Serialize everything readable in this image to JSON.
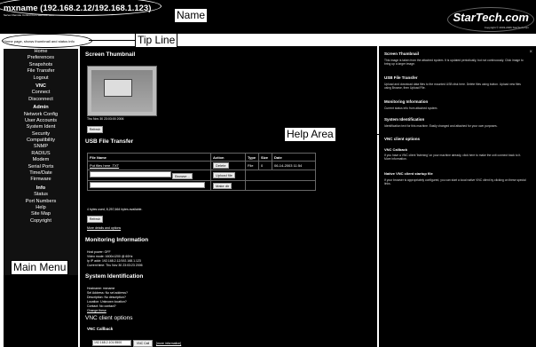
{
  "header": {
    "title": "mxname (192.168.2.12/192.168.1.123)",
    "subtitle": "Server Remote Control from StarTech.com",
    "logo_text": "StarTech.com",
    "logo_copyright": "Copyright © 2003-2006 StarTech.com"
  },
  "tip_line": {
    "text": "Home page, shows thumbnail and status info"
  },
  "sidebar": {
    "groups": [
      {
        "heading": "",
        "items": [
          "Home",
          "Preferences",
          "Snapshots",
          "File Transfer",
          "Logout"
        ]
      },
      {
        "heading": "VNC",
        "items": [
          "Connect",
          "Disconnect"
        ]
      },
      {
        "heading": "Admin",
        "items": [
          "Network Config",
          "User Accounts",
          "System Ident",
          "Security",
          "Compatibility",
          "SNMP",
          "RADIUS",
          "Modem",
          "Serial Ports",
          "Time/Date",
          "Firmware"
        ]
      },
      {
        "heading": "Info",
        "items": [
          "Status",
          "Port Numbers",
          "Help",
          "Site Map",
          "Copyright"
        ]
      }
    ]
  },
  "main": {
    "thumbnail": {
      "title": "Screen Thumbnail",
      "timestamp": "Thu Nov 30 23:03:00 2006",
      "refresh": "Refresh"
    },
    "file_transfer": {
      "title": "USB File Transfer",
      "columns": [
        "File Name",
        "Action",
        "Type",
        "Size",
        "Date"
      ],
      "rows": [
        {
          "name": "Put files here    .TXT",
          "action": "Delete",
          "type": "File",
          "size": "0",
          "date": "06-14-2003 11:54"
        }
      ],
      "browse_label": "Browse...",
      "upload_label": "Upload file",
      "mkdir_label": "Make dir",
      "usage": "4 bytes used, 8,257,664 bytes available.",
      "refresh": "Refresh",
      "more_link": "More details and options"
    },
    "monitoring": {
      "title": "Monitoring Information",
      "lines": [
        "Host power: OFF",
        "Video mode: 1600x1200 @ 60Hz",
        "Ip IP addr: 192.168.2.12/192.168.1.123",
        "Current time: Thu Nov 30 23:03:23 2006"
      ]
    },
    "system_id": {
      "title": "System Identification",
      "lines": [
        "Hostname: mxname",
        "Sel Address: No sel address?",
        "Description: No description?",
        "Location: Unknown location?",
        "Contact: No contact?"
      ],
      "change_link": "Change these"
    },
    "vnc_options": {
      "title": "VNC client options",
      "callback_title": "VNC Callback",
      "callback_value": "192.168.2.101:5500",
      "callback_button": "VNC Call Back",
      "more_info": "[more information]"
    }
  },
  "help": {
    "close": "×",
    "sections": [
      {
        "heading": "Screen Thumbnail",
        "text": "This image is taken from the attached system. It is updated periodically, but not continuously. Click image to bring up a larger image."
      },
      {
        "heading": "USB File Transfer",
        "text": "Upload and download data files to the mounted USB disk here. Delete files using button. Upload new files using Browse, then Upload File."
      },
      {
        "heading": "Monitoring Information",
        "text": "Current status info from attached system."
      },
      {
        "heading": "System Identification",
        "text": "Identification text for this machine. Easily changed and attached for your own purposes."
      },
      {
        "heading": "VNC client options",
        "text": ""
      },
      {
        "heading": "VNC Callback",
        "text": "If you have a VNC client 'listening' on your machine already, click here to make the unit connect back to it. More information."
      },
      {
        "heading": "Native VNC client startup file",
        "text": "If your browser is appropriately configured, you can start a local native VNC client by clicking on these special links."
      }
    ]
  },
  "callouts": {
    "name": "Name",
    "tip_line": "Tip Line",
    "help_area": "Help Area",
    "main_menu": "Main Menu"
  }
}
